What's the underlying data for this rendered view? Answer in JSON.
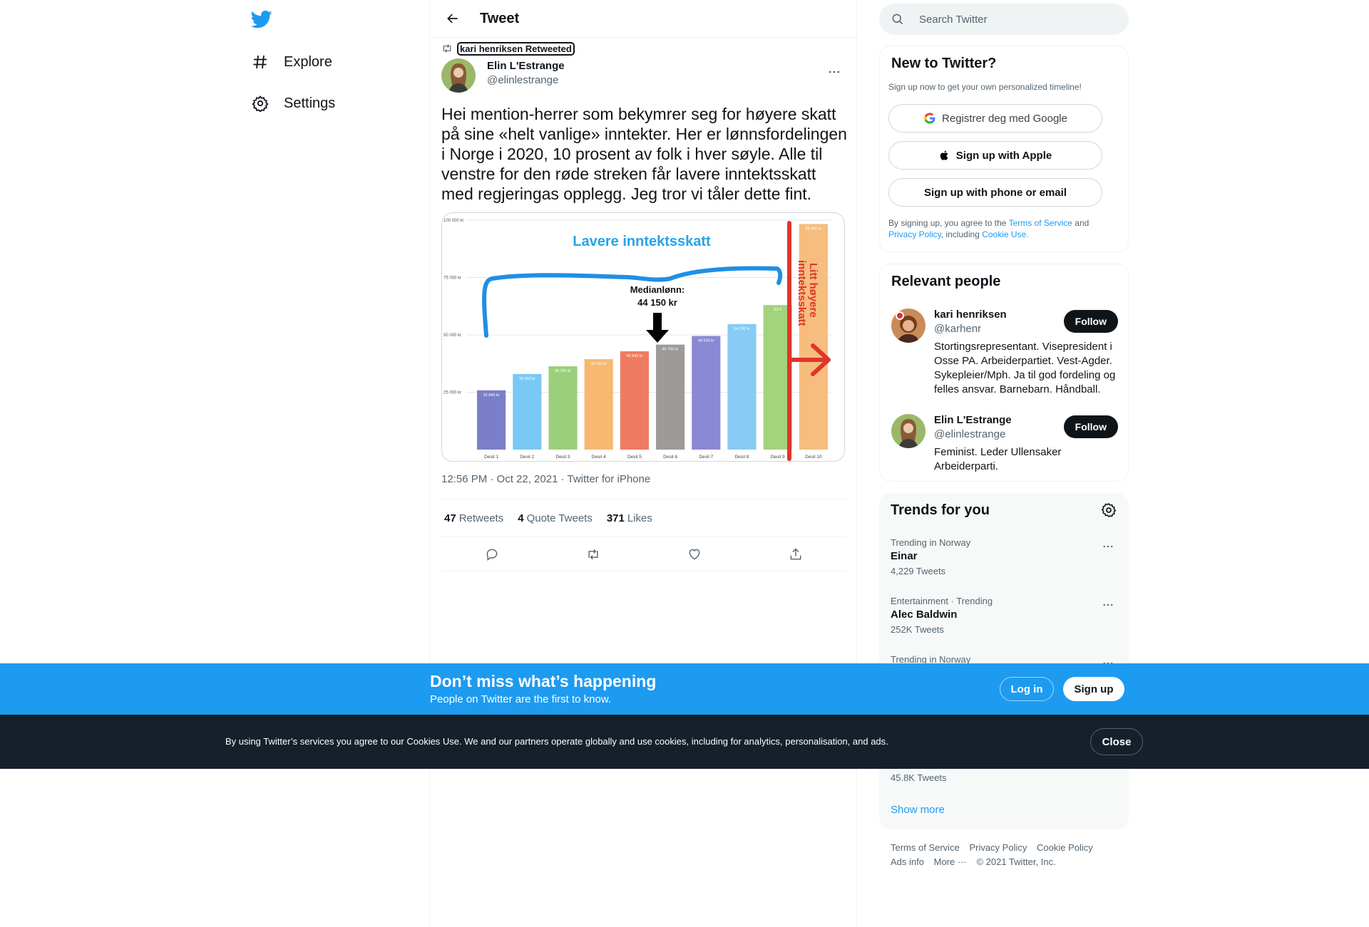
{
  "nav": {
    "items": [
      {
        "label": "Explore",
        "icon": "hashtag-icon"
      },
      {
        "label": "Settings",
        "icon": "gear-icon"
      }
    ]
  },
  "header": {
    "title": "Tweet"
  },
  "tweet": {
    "retweeted_by": "kari henriksen Retweeted",
    "author_name": "Elin L'Estrange",
    "author_handle": "@elinlestrange",
    "text": "Hei mention-herrer som bekymrer seg for høyere skatt på sine «helt vanlige» inntekter. Her er lønnsfordelingen i Norge i 2020, 10 prosent av folk i hver søyle. Alle til venstre for den røde streken får lavere inntektsskatt med regjeringas opplegg. Jeg tror vi tåler dette fint.",
    "meta": "12:56 PM · Oct 22, 2021 · Twitter for iPhone",
    "stats": {
      "retweets_count": "47",
      "retweets_label": "Retweets",
      "quotes_count": "4",
      "quotes_label": "Quote Tweets",
      "likes_count": "371",
      "likes_label": "Likes"
    },
    "media": {
      "top_label": "Lavere inntektsskatt",
      "median_label_1": "Medianlønn:",
      "median_label_2": "44 150 kr",
      "right_label_1": "Litt høyere",
      "right_label_2": "inntektsskatt"
    }
  },
  "chart_data": {
    "type": "bar",
    "categories": [
      "Desil 1",
      "Desil 2",
      "Desil 3",
      "Desil 4",
      "Desil 5",
      "Desil 6",
      "Desil 7",
      "Desil 8",
      "Desil 9",
      "Desil 10"
    ],
    "values": [
      25840,
      32950,
      36300,
      39410,
      42840,
      45760,
      49530,
      54730,
      63000,
      98300
    ],
    "value_labels": [
      "25 840 kr",
      "32 950 kr",
      "36 300 kr",
      "39 410 kr",
      "42 840 kr",
      "45 760 kr",
      "49 530 kr",
      "54 730 kr",
      "63 0",
      "98 300 kr"
    ],
    "bar_colors": [
      "#7b7fc9",
      "#7ac8f5",
      "#9bcf7a",
      "#f7b870",
      "#ef7b62",
      "#9e9a97",
      "#8b89d4",
      "#86ccf4",
      "#a3d37d",
      "#f6bd7e"
    ],
    "ylim": [
      0,
      100000
    ],
    "yticks": [
      25000,
      50000,
      75000,
      100000
    ],
    "ytick_labels": [
      "25 000 kr",
      "50 000 kr",
      "75 000 kr",
      "100 000 kr"
    ],
    "title": "",
    "xlabel": "",
    "ylabel": ""
  },
  "search": {
    "placeholder": "Search Twitter"
  },
  "new_to_twitter": {
    "title": "New to Twitter?",
    "subtitle": "Sign up now to get your own personalized timeline!",
    "google_label": "Registrer deg med Google",
    "apple_label": "Sign up with Apple",
    "phone_label": "Sign up with phone or email",
    "legal_1": "By signing up, you agree to the",
    "tos": "Terms of Service",
    "legal_and": "and",
    "privacy": "Privacy Policy",
    "legal_including": ", including",
    "cookie_use": "Cookie Use."
  },
  "relevant_people": {
    "title": "Relevant people",
    "people": [
      {
        "name": "kari henriksen",
        "handle": "@karhenr",
        "bio": "Stortingsrepresentant. Visepresident i Osse PA. Arbeiderpartiet. Vest-Agder. Sykepleier/Mph. Ja til god fordeling og felles ansvar. Barnebarn. Håndball.",
        "follow": "Follow"
      },
      {
        "name": "Elin L'Estrange",
        "handle": "@elinlestrange",
        "bio": "Feminist. Leder Ullensaker Arbeiderparti.",
        "follow": "Follow"
      }
    ]
  },
  "trends": {
    "title": "Trends for you",
    "items": [
      {
        "context": "Trending in Norway",
        "name": "Einar",
        "count": "4,229 Tweets"
      },
      {
        "context": "Entertainment · Trending",
        "name": "Alec Baldwin",
        "count": "252K Tweets"
      },
      {
        "context": "Trending in Norway",
        "name": "",
        "count": ""
      }
    ],
    "last_count": "45.8K Tweets",
    "show_more": "Show more"
  },
  "footer": {
    "links": [
      "Terms of Service",
      "Privacy Policy",
      "Cookie Policy",
      "Ads info",
      "More ···"
    ],
    "copyright": "© 2021 Twitter, Inc."
  },
  "banner": {
    "title": "Don’t miss what’s happening",
    "subtitle": "People on Twitter are the first to know.",
    "login": "Log in",
    "signup": "Sign up"
  },
  "cookie": {
    "text": "By using Twitter’s services you agree to our Cookies Use. We and our partners operate globally and use cookies, including for analytics, personalisation, and ads.",
    "close": "Close"
  },
  "colors": {
    "brand": "#1d9bf0",
    "text": "#0f1419",
    "muted": "#536471",
    "red_line": "#e0352b"
  }
}
